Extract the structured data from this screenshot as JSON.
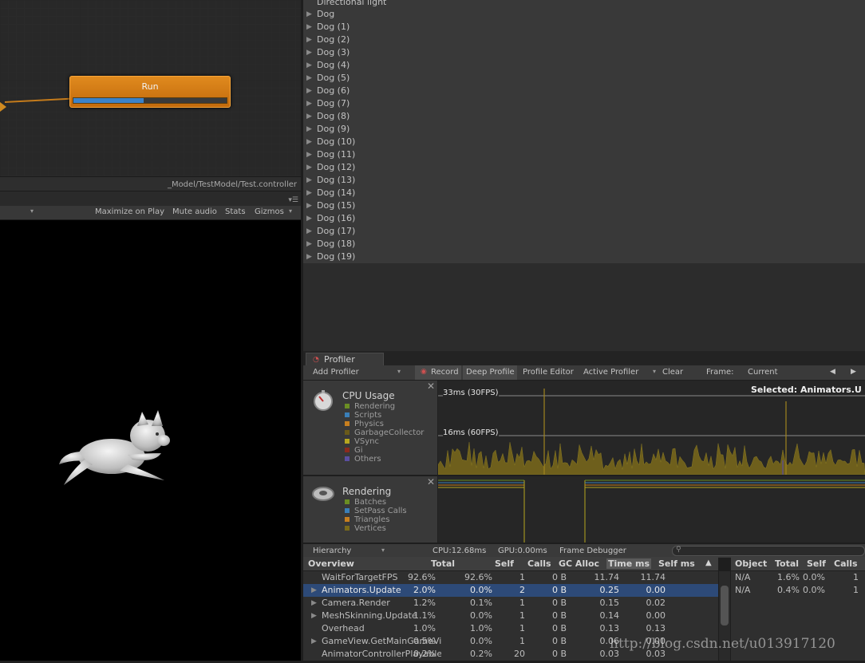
{
  "animator": {
    "state_label": "Run",
    "state_progress": 0.46,
    "controller_path": "_Model/TestModel/Test.controller"
  },
  "game_toolbar": {
    "maximize_on_play": "Maximize on Play",
    "mute_audio": "Mute audio",
    "stats": "Stats",
    "gizmos": "Gizmos"
  },
  "hierarchy": {
    "partial_top": "Directional light",
    "items": [
      "Dog",
      "Dog (1)",
      "Dog (2)",
      "Dog (3)",
      "Dog (4)",
      "Dog (5)",
      "Dog (6)",
      "Dog (7)",
      "Dog (8)",
      "Dog (9)",
      "Dog (10)",
      "Dog (11)",
      "Dog (12)",
      "Dog (13)",
      "Dog (14)",
      "Dog (15)",
      "Dog (16)",
      "Dog (17)",
      "Dog (18)",
      "Dog (19)"
    ]
  },
  "profiler": {
    "tab_label": "Profiler",
    "toolbar": {
      "add_profiler": "Add Profiler",
      "record": "Record",
      "deep_profile": "Deep Profile",
      "profile_editor": "Profile Editor",
      "active_profiler": "Active Profiler",
      "clear": "Clear",
      "frame_label": "Frame:",
      "frame_value": "Current"
    },
    "cpu_lane": {
      "title": "CPU Usage",
      "legend": [
        {
          "label": "Rendering",
          "color": "#6b8e23"
        },
        {
          "label": "Scripts",
          "color": "#3a7fb8"
        },
        {
          "label": "Physics",
          "color": "#c77f1f"
        },
        {
          "label": "GarbageCollector",
          "color": "#6a5a1a"
        },
        {
          "label": "VSync",
          "color": "#b7a71f"
        },
        {
          "label": "Gi",
          "color": "#8b2a1e"
        },
        {
          "label": "Others",
          "color": "#5a4ea0"
        }
      ],
      "line_33": "33ms (30FPS)",
      "line_16": "16ms (60FPS)",
      "selected": "Selected: Animators.U"
    },
    "render_lane": {
      "title": "Rendering",
      "legend": [
        {
          "label": "Batches",
          "color": "#6b8e23"
        },
        {
          "label": "SetPass Calls",
          "color": "#3a7fb8"
        },
        {
          "label": "Triangles",
          "color": "#c77f1f"
        },
        {
          "label": "Vertices",
          "color": "#7a6a1a"
        }
      ]
    },
    "hier_bar": {
      "view": "Hierarchy",
      "cpu": "CPU:12.68ms",
      "gpu": "GPU:0.00ms",
      "frame_debugger": "Frame Debugger"
    },
    "table": {
      "headers": [
        "Overview",
        "Total",
        "Self",
        "Calls",
        "GC Alloc",
        "Time ms",
        "Self ms"
      ],
      "sort_icon": "▲",
      "rows": [
        {
          "name": "WaitForTargetFPS",
          "total": "92.6%",
          "self": "92.6%",
          "calls": "1",
          "gc": "0 B",
          "time": "11.74",
          "selfms": "11.74",
          "expand": false,
          "selected": false
        },
        {
          "name": "Animators.Update",
          "total": "2.0%",
          "self": "0.0%",
          "calls": "2",
          "gc": "0 B",
          "time": "0.25",
          "selfms": "0.00",
          "expand": true,
          "selected": true
        },
        {
          "name": "Camera.Render",
          "total": "1.2%",
          "self": "0.1%",
          "calls": "1",
          "gc": "0 B",
          "time": "0.15",
          "selfms": "0.02",
          "expand": true,
          "selected": false
        },
        {
          "name": "MeshSkinning.Update",
          "total": "1.1%",
          "self": "0.0%",
          "calls": "1",
          "gc": "0 B",
          "time": "0.14",
          "selfms": "0.00",
          "expand": true,
          "selected": false
        },
        {
          "name": "Overhead",
          "total": "1.0%",
          "self": "1.0%",
          "calls": "1",
          "gc": "0 B",
          "time": "0.13",
          "selfms": "0.13",
          "expand": false,
          "selected": false
        },
        {
          "name": "GameView.GetMainGameVi",
          "total": "0.5%",
          "self": "0.0%",
          "calls": "1",
          "gc": "0 B",
          "time": "0.06",
          "selfms": "0.00",
          "expand": true,
          "selected": false
        },
        {
          "name": "AnimatorControllerPlayable",
          "total": "0.2%",
          "self": "0.2%",
          "calls": "20",
          "gc": "0 B",
          "time": "0.03",
          "selfms": "0.03",
          "expand": false,
          "selected": false
        }
      ]
    },
    "object_table": {
      "headers": [
        "Object",
        "Total",
        "Self",
        "Calls"
      ],
      "rows": [
        {
          "object": "N/A",
          "total": "1.6%",
          "self": "0.0%",
          "calls": "1"
        },
        {
          "object": "N/A",
          "total": "0.4%",
          "self": "0.0%",
          "calls": "1"
        }
      ]
    }
  },
  "watermark": "http://blog.csdn.net/u013917120"
}
